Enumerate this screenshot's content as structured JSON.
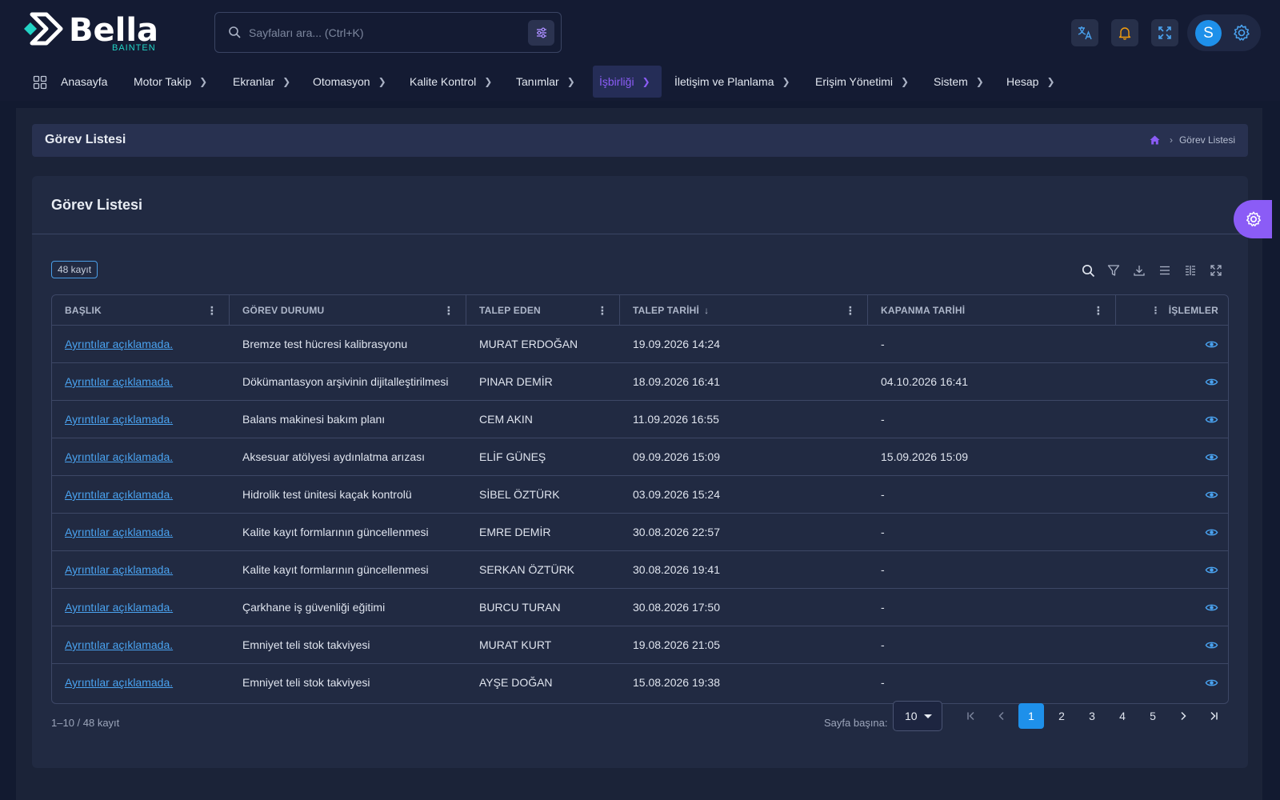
{
  "brand": {
    "name": "Bella",
    "sub": "BAINTEN"
  },
  "search": {
    "placeholder": "Sayfaları ara... (Ctrl+K)"
  },
  "user": {
    "initial": "S"
  },
  "nav": [
    {
      "label": "Anasayfa",
      "chevron": false,
      "active": false
    },
    {
      "label": "Motor Takip",
      "chevron": true,
      "active": false
    },
    {
      "label": "Ekranlar",
      "chevron": true,
      "active": false
    },
    {
      "label": "Otomasyon",
      "chevron": true,
      "active": false
    },
    {
      "label": "Kalite Kontrol",
      "chevron": true,
      "active": false
    },
    {
      "label": "Tanımlar",
      "chevron": true,
      "active": false
    },
    {
      "label": "İşbirliği",
      "chevron": true,
      "active": true
    },
    {
      "label": "İletişim ve Planlama",
      "chevron": true,
      "active": false
    },
    {
      "label": "Erişim Yönetimi",
      "chevron": true,
      "active": false
    },
    {
      "label": "Sistem",
      "chevron": true,
      "active": false
    },
    {
      "label": "Hesap",
      "chevron": true,
      "active": false
    }
  ],
  "page": {
    "title": "Görev Listesi",
    "breadcrumb": "Görev Listesi"
  },
  "card": {
    "title": "Görev Listesi",
    "count": "48 kayıt"
  },
  "table": {
    "columns": [
      "BAŞLIK",
      "GÖREV DURUMU",
      "TALEP EDEN",
      "TALEP TARİHİ",
      "KAPANMA TARİHİ",
      "İŞLEMLER"
    ],
    "rows": [
      {
        "title": "Ayrıntılar açıklamada.",
        "status": "Bremze test hücresi kalibrasyonu",
        "requester": "MURAT ERDOĞAN",
        "requested": "19.09.2026 14:24",
        "closed": "-"
      },
      {
        "title": "Ayrıntılar açıklamada.",
        "status": "Dökümantasyon arşivinin dijitalleştirilmesi",
        "requester": "PINAR DEMİR",
        "requested": "18.09.2026 16:41",
        "closed": "04.10.2026 16:41"
      },
      {
        "title": "Ayrıntılar açıklamada.",
        "status": "Balans makinesi bakım planı",
        "requester": "CEM AKIN",
        "requested": "11.09.2026 16:55",
        "closed": "-"
      },
      {
        "title": "Ayrıntılar açıklamada.",
        "status": "Aksesuar atölyesi aydınlatma arızası",
        "requester": "ELİF GÜNEŞ",
        "requested": "09.09.2026 15:09",
        "closed": "15.09.2026 15:09"
      },
      {
        "title": "Ayrıntılar açıklamada.",
        "status": "Hidrolik test ünitesi kaçak kontrolü",
        "requester": "SİBEL ÖZTÜRK",
        "requested": "03.09.2026 15:24",
        "closed": "-"
      },
      {
        "title": "Ayrıntılar açıklamada.",
        "status": "Kalite kayıt formlarının güncellenmesi",
        "requester": "EMRE DEMİR",
        "requested": "30.08.2026 22:57",
        "closed": "-"
      },
      {
        "title": "Ayrıntılar açıklamada.",
        "status": "Kalite kayıt formlarının güncellenmesi",
        "requester": "SERKAN ÖZTÜRK",
        "requested": "30.08.2026 19:41",
        "closed": "-"
      },
      {
        "title": "Ayrıntılar açıklamada.",
        "status": "Çarkhane iş güvenliği eğitimi",
        "requester": "BURCU TURAN",
        "requested": "30.08.2026 17:50",
        "closed": "-"
      },
      {
        "title": "Ayrıntılar açıklamada.",
        "status": "Emniyet teli stok takviyesi",
        "requester": "MURAT KURT",
        "requested": "19.08.2026 21:05",
        "closed": "-"
      },
      {
        "title": "Ayrıntılar açıklamada.",
        "status": "Emniyet teli stok takviyesi",
        "requester": "AYŞE DOĞAN",
        "requested": "15.08.2026 19:38",
        "closed": "-"
      }
    ]
  },
  "pagination": {
    "info": "1–10 / 48 kayıt",
    "per_page_label": "Sayfa başına:",
    "per_page": "10",
    "pages": [
      "1",
      "2",
      "3",
      "4",
      "5"
    ],
    "current": "1"
  },
  "colors": {
    "accent": "#8b5cf6",
    "primary": "#1e90ea",
    "link": "#4aa3f0",
    "bg": "#121a30"
  }
}
